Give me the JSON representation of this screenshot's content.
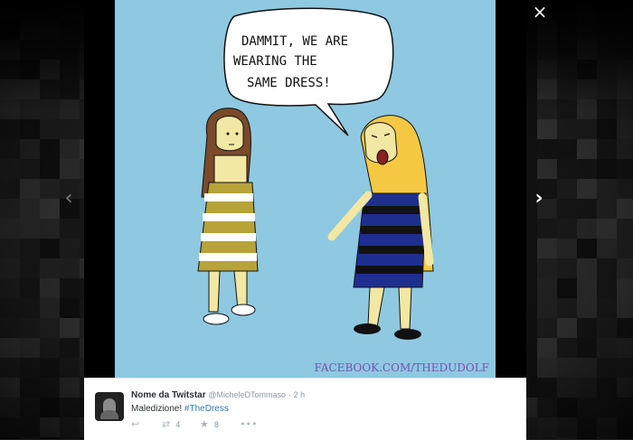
{
  "viewer": {
    "close_label": "×",
    "prev_label": "‹",
    "next_label": "›"
  },
  "comic": {
    "speech_lines": [
      "DAMMIT, WE ARE",
      "WEARING THE",
      "SAME DRESS!"
    ],
    "watermark": "FACEBOOK.COM/THEDUDOLF",
    "sky_color": "#8ec9e1",
    "dress_left_colors": [
      "#b8a23a",
      "#ffffff"
    ],
    "dress_right_colors": [
      "#1f2f8f",
      "#111111"
    ]
  },
  "tweet": {
    "display_name": "Nome da Twitstar",
    "handle": "@MicheleDTommaso",
    "separator": "·",
    "time": "2 h",
    "text_plain": "Maledizione! ",
    "hashtag": "#TheDress",
    "actions": {
      "reply_icon": "reply-icon",
      "retweet_icon": "retweet-icon",
      "retweet_count": "4",
      "favorite_icon": "star-icon",
      "favorite_count": "8",
      "more_icon": "more-icon"
    }
  }
}
